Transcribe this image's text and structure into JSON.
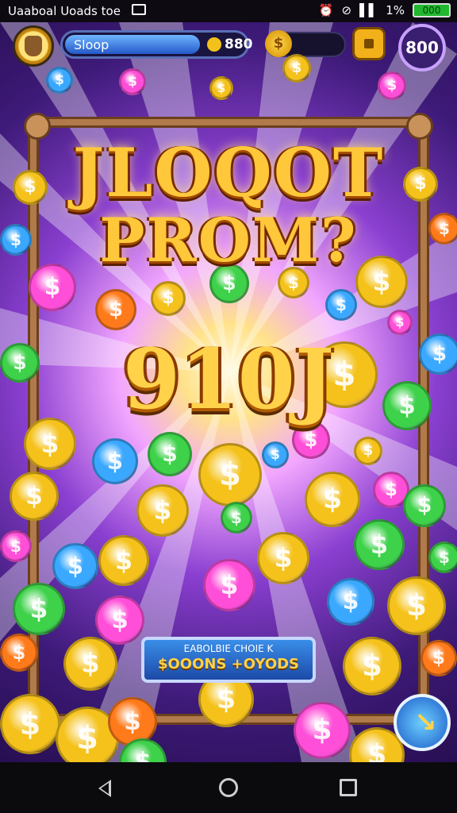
{
  "status_bar": {
    "left_text": "Uaaboal Uoads toe",
    "right_text": "1%",
    "battery_text": "000"
  },
  "hud": {
    "balance_label": "Sloop",
    "balance_value": "880",
    "level_value": "800",
    "coin_symbol": "$"
  },
  "title_line1": "JLOQOT",
  "title_line2": "PROM?",
  "jackpot_text": "910J",
  "bonus_panel": {
    "line1": "EABOLBIE CHOIE K",
    "line2": "$OOONS +OYODS"
  },
  "colors": {
    "gold": "#ffc83a",
    "frame": "#b07a4a",
    "panel": "#1c4aa8"
  }
}
